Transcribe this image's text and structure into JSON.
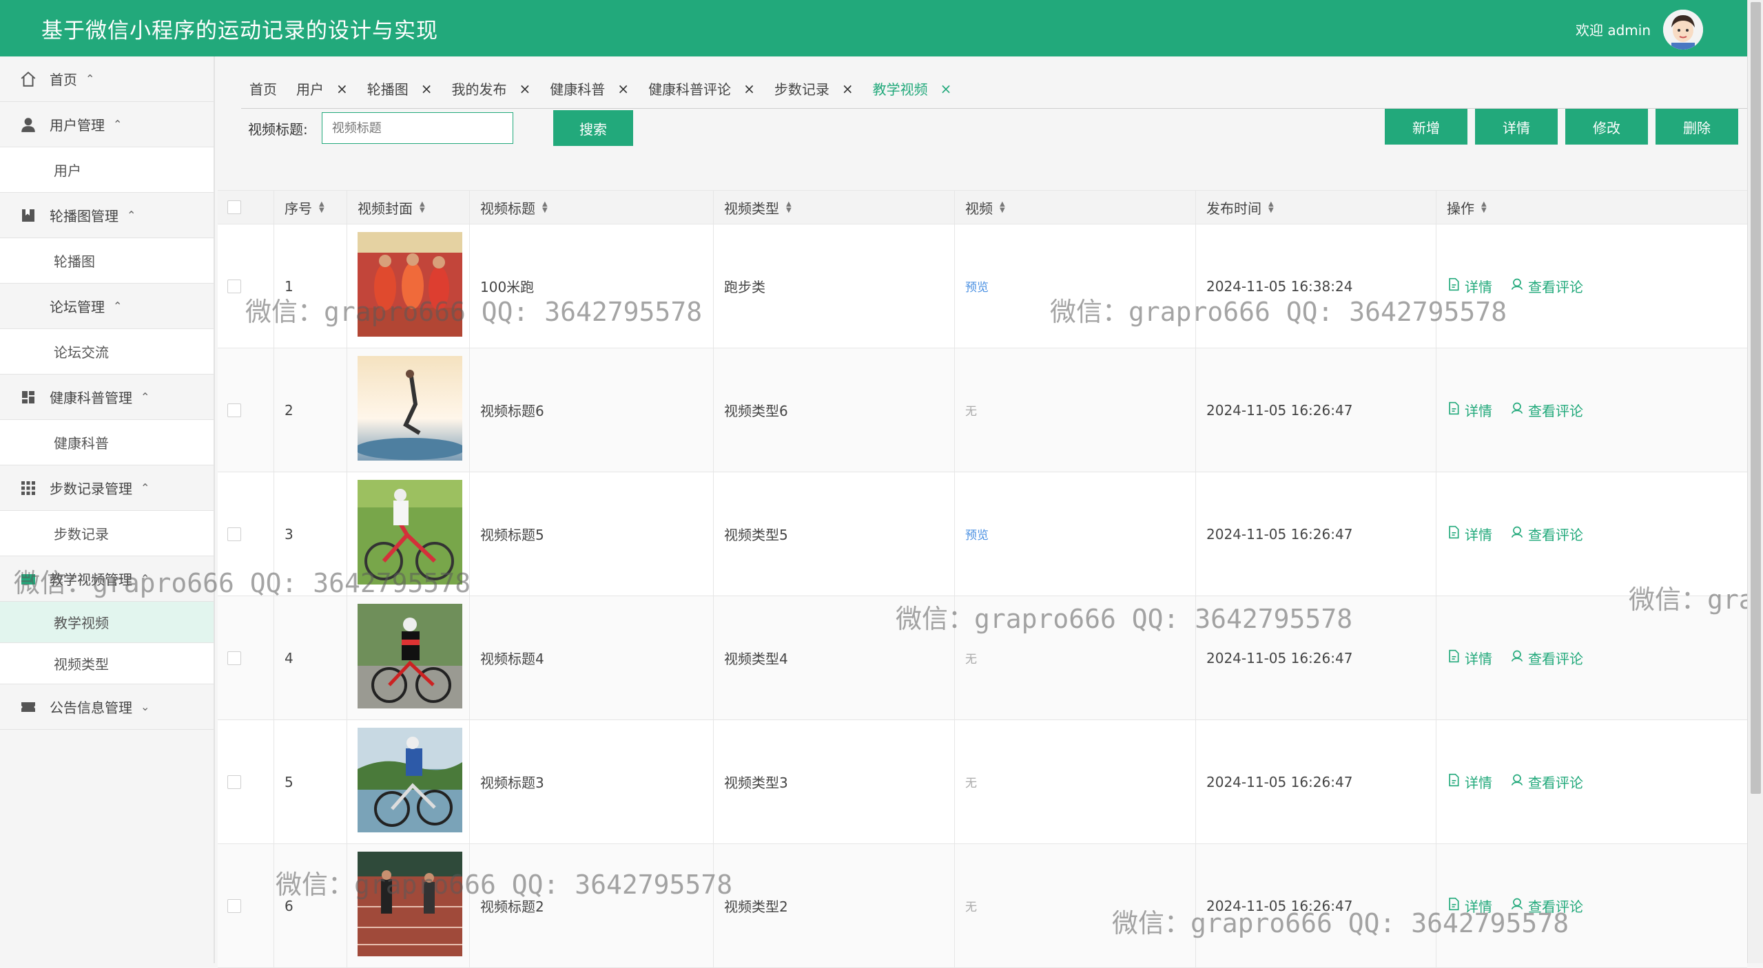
{
  "header": {
    "title": "基于微信小程序的运动记录的设计与实现",
    "welcome": "欢迎 admin"
  },
  "sidebar": {
    "items": [
      {
        "label": "首页",
        "caret": "^",
        "icon": "home-icon"
      },
      {
        "label": "用户管理",
        "caret": "^",
        "icon": "user-icon",
        "sub": [
          "用户"
        ]
      },
      {
        "label": "轮播图管理",
        "caret": "^",
        "icon": "bookmark-icon",
        "sub": [
          "轮播图"
        ]
      },
      {
        "label": "论坛管理",
        "caret": "^",
        "icon": "none",
        "sub": [
          "论坛交流"
        ]
      },
      {
        "label": "健康科普管理",
        "caret": "^",
        "icon": "dashboard-icon",
        "sub": [
          "健康科普"
        ]
      },
      {
        "label": "步数记录管理",
        "caret": "^",
        "icon": "grid-icon",
        "sub": [
          "步数记录"
        ]
      },
      {
        "label": "教学视频管理",
        "caret": "^",
        "icon": "folder-icon",
        "sub": [
          "教学视频",
          "视频类型"
        ]
      },
      {
        "label": "公告信息管理",
        "caret": "v",
        "icon": "ticket-icon"
      }
    ]
  },
  "tabs": [
    "首页",
    "用户",
    "轮播图",
    "我的发布",
    "健康科普",
    "健康科普评论",
    "步数记录",
    "教学视频"
  ],
  "tab_close": "×",
  "search": {
    "label": "视频标题:",
    "placeholder": "视频标题",
    "button": "搜索"
  },
  "actions": [
    "新增",
    "详情",
    "修改",
    "删除"
  ],
  "table": {
    "headers": [
      "序号",
      "视频封面",
      "视频标题",
      "视频类型",
      "视频",
      "发布时间",
      "操作"
    ],
    "rows": [
      {
        "no": "1",
        "title": "100米跑",
        "type": "跑步类",
        "video": "预览",
        "time": "2024-11-05 16:38:24"
      },
      {
        "no": "2",
        "title": "视频标题6",
        "type": "视频类型6",
        "video": "无",
        "time": "2024-11-05 16:26:47"
      },
      {
        "no": "3",
        "title": "视频标题5",
        "type": "视频类型5",
        "video": "预览",
        "time": "2024-11-05 16:26:47"
      },
      {
        "no": "4",
        "title": "视频标题4",
        "type": "视频类型4",
        "video": "无",
        "time": "2024-11-05 16:26:47"
      },
      {
        "no": "5",
        "title": "视频标题3",
        "type": "视频类型3",
        "video": "无",
        "time": "2024-11-05 16:26:47"
      },
      {
        "no": "6",
        "title": "视频标题2",
        "type": "视频类型2",
        "video": "无",
        "time": "2024-11-05 16:26:47"
      }
    ],
    "op_detail": "详情",
    "op_comment": "查看评论"
  },
  "watermark": "微信：grapro666 QQ: 3642795578",
  "colors": {
    "accent": "#22a97b",
    "link": "#4a90e2"
  }
}
